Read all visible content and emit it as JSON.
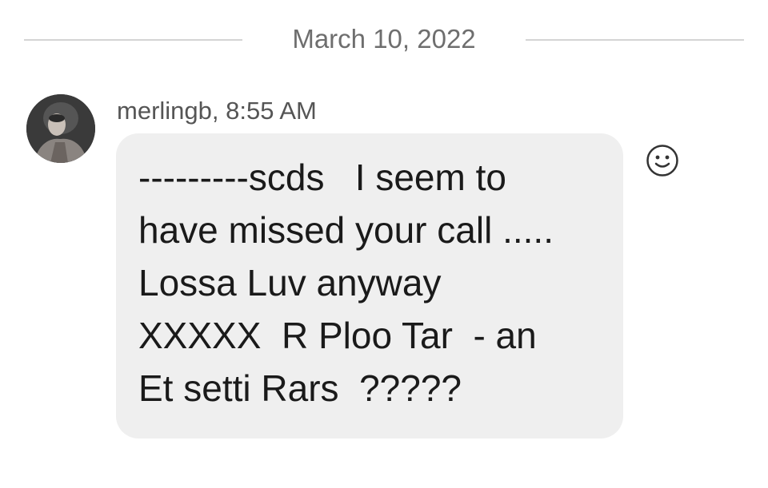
{
  "date_divider": {
    "label": "March 10, 2022"
  },
  "message": {
    "sender": "merlingb",
    "time": "8:55 AM",
    "header": "merlingb, 8:55 AM",
    "text": "---------scds   I seem to\nhave missed your call .....\nLossa Luv anyway\nXXXXX  R Ploo Tar  - an\nEt setti Rars  ?????",
    "avatar_icon": "user-avatar-photo",
    "react_icon": "smiley-face-icon"
  },
  "colors": {
    "bubble": "#efefef",
    "divider_line": "#d4d4d4",
    "meta_text": "#6e6e6e",
    "message_text": "#1a1a1a"
  }
}
